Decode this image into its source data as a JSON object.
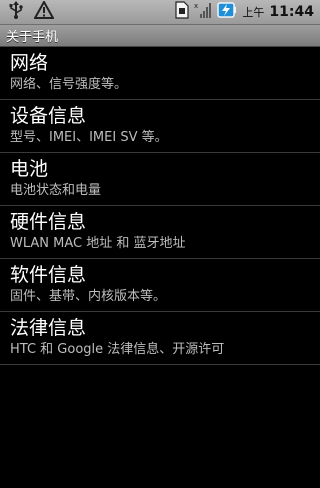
{
  "status_bar": {
    "time": "11:44",
    "ampm": "上午",
    "icons": [
      "usb-icon",
      "warning-icon",
      "sim-icon",
      "signal-icon",
      "battery-charging-icon"
    ]
  },
  "title": "关于手机",
  "items": [
    {
      "title": "网络",
      "summary": "网络、信号强度等。"
    },
    {
      "title": "设备信息",
      "summary": "型号、IMEI、IMEI SV 等。"
    },
    {
      "title": "电池",
      "summary": "电池状态和电量"
    },
    {
      "title": "硬件信息",
      "summary": "WLAN MAC 地址 和 蓝牙地址"
    },
    {
      "title": "软件信息",
      "summary": "固件、基带、内核版本等。"
    },
    {
      "title": "法律信息",
      "summary": "HTC 和 Google 法律信息、开源许可"
    }
  ]
}
